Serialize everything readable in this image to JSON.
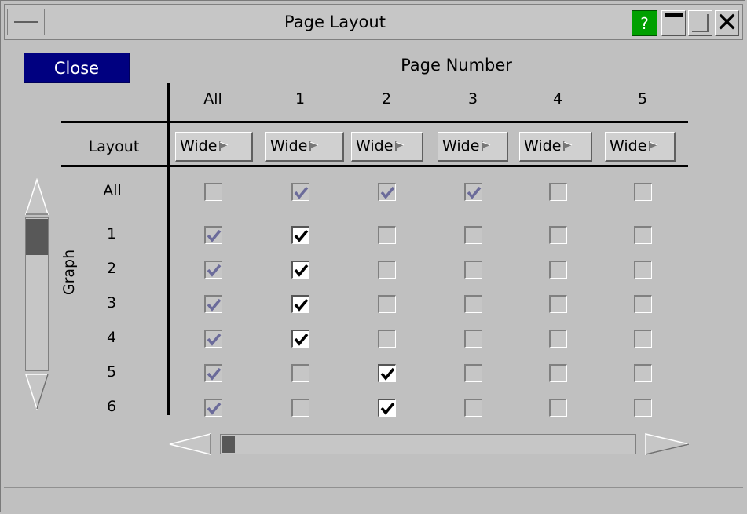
{
  "window": {
    "title": "Page Layout",
    "help_label": "?"
  },
  "close_label": "Close",
  "page_number_heading": "Page Number",
  "columns": [
    "All",
    "1",
    "2",
    "3",
    "4",
    "5"
  ],
  "layout_row_label": "Layout",
  "layout_values": [
    "Wide",
    "Wide",
    "Wide",
    "Wide",
    "Wide",
    "Wide"
  ],
  "graph_axis_label": "Graph",
  "rows": [
    {
      "label": "All",
      "cells": [
        "off",
        "inherited",
        "inherited",
        "inherited",
        "off",
        "off"
      ]
    },
    {
      "label": "1",
      "cells": [
        "inherited",
        "on",
        "off",
        "off",
        "off",
        "off"
      ]
    },
    {
      "label": "2",
      "cells": [
        "inherited",
        "on",
        "off",
        "off",
        "off",
        "off"
      ]
    },
    {
      "label": "3",
      "cells": [
        "inherited",
        "on",
        "off",
        "off",
        "off",
        "off"
      ]
    },
    {
      "label": "4",
      "cells": [
        "inherited",
        "on",
        "off",
        "off",
        "off",
        "off"
      ]
    },
    {
      "label": "5",
      "cells": [
        "inherited",
        "off",
        "on",
        "off",
        "off",
        "off"
      ]
    },
    {
      "label": "6",
      "cells": [
        "inherited",
        "off",
        "on",
        "off",
        "off",
        "off"
      ]
    }
  ],
  "colors": {
    "close_button_bg": "#000080",
    "help_button_bg": "#00a000",
    "check_on": "#000000",
    "check_inherited": "#6b6b9a"
  },
  "icons": {
    "system_menu": "system-menu-icon",
    "help": "help-icon",
    "minimize": "minimize-icon",
    "maximize": "maximize-icon",
    "close": "close-icon",
    "dropdown": "flag-arrow-icon",
    "scroll_up": "scroll-up-arrow-icon",
    "scroll_down": "scroll-down-arrow-icon",
    "scroll_left": "scroll-left-arrow-icon",
    "scroll_right": "scroll-right-arrow-icon"
  }
}
